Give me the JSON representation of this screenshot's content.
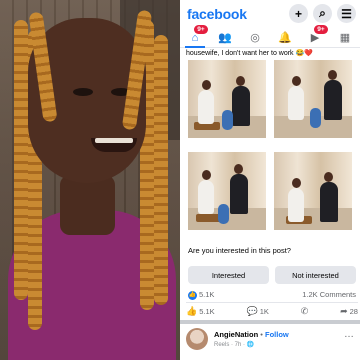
{
  "facebook": {
    "logo": "facebook",
    "top_icons": {
      "plus": "+",
      "search": "⌕",
      "menu": "☰"
    },
    "nav": [
      {
        "name": "home",
        "icon": "⌂",
        "badge": "9+",
        "active": true
      },
      {
        "name": "friends",
        "icon": "👥",
        "badge": ""
      },
      {
        "name": "messenger",
        "icon": "◎",
        "badge": ""
      },
      {
        "name": "notifications",
        "icon": "🔔",
        "badge": ""
      },
      {
        "name": "watch-video",
        "icon": "▶",
        "badge": "9+"
      },
      {
        "name": "marketplace",
        "icon": "▦",
        "badge": ""
      }
    ],
    "post": {
      "caption": "housewife, I don't want her to work 😂❤️",
      "question": "Are you interested in this post?",
      "interested_label": "Interested",
      "not_interested_label": "Not interested",
      "reactions_count": "5.1K",
      "comments_count": "1.2K Comments",
      "actions": {
        "like": "5.1K",
        "comment": "1K",
        "share": "28"
      }
    },
    "next_post": {
      "author": "AngieNation",
      "separator": "•",
      "follow": "Follow",
      "meta": "Reels · 7h · 🌐",
      "more": "…"
    }
  }
}
